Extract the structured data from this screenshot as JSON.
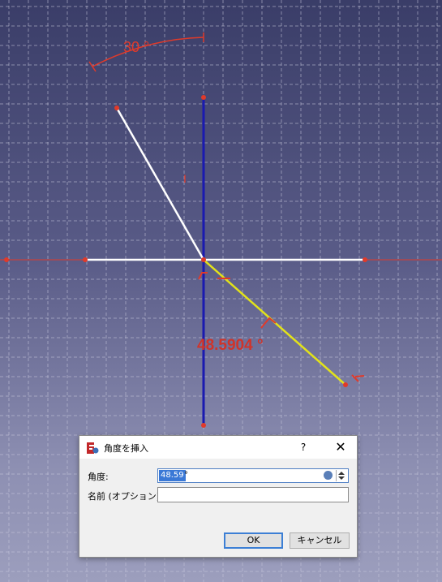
{
  "sketch": {
    "dim_top_label": "30 °",
    "dim_bottom_label": "48.5904 °",
    "constraint_mark": "I"
  },
  "dialog": {
    "title": "角度を挿入",
    "help_label": "?",
    "close_label": "✕",
    "angle_label": "角度:",
    "angle_value": "48.59",
    "angle_unit": "°",
    "name_label": "名前 (オプション)",
    "name_value": "",
    "ok_label": "OK",
    "cancel_label": "キャンセル"
  },
  "colors": {
    "construction_red": "#e03a2a",
    "axis_blue": "#1a1ab0",
    "selected_yellow": "#e2e21a",
    "line_white": "#ffffff",
    "accent_blue": "#3a78d6"
  }
}
